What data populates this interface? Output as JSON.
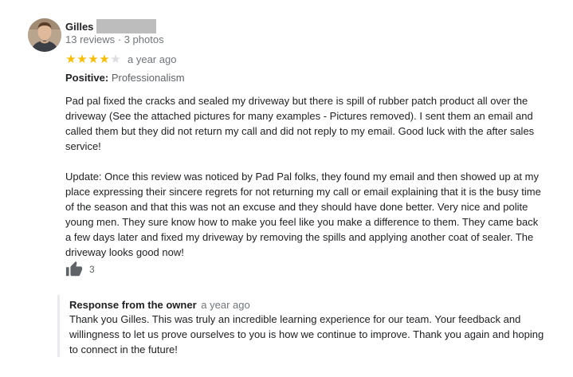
{
  "reviewer": {
    "name": "Gilles",
    "meta": "13 reviews · 3 photos",
    "avatar_icon": "person-photo-icon"
  },
  "rating": {
    "stars": 4,
    "max_stars": 5,
    "date": "a year ago",
    "star_color": "#fbbc04",
    "empty_star_color": "#dadce0"
  },
  "positive": {
    "label": "Positive:",
    "value": "Professionalism"
  },
  "review": {
    "paragraph1": "Pad pal fixed the cracks and sealed my driveway but there is spill of rubber patch product all over the driveway (See the attached pictures for many examples - Pictures removed). I sent them an email and called them but they did not return my call and did not reply to my email. Good luck with the after sales service!",
    "paragraph2": "Update: Once this review was noticed by Pad Pal folks, they found my email and then showed up at my place expressing their sincere  regrets for not returning my call or email explaining that it is the busy time of the season and that this was not an excuse and they should have done better. Very nice and polite young men. They sure know how to make you feel like you make a difference to them. They came back a few days later and fixed my driveway by removing the spills and applying another coat of sealer. The driveway looks good now!"
  },
  "likes": {
    "icon": "thumbs-up-icon",
    "count": "3"
  },
  "owner_response": {
    "label": "Response from the owner",
    "date": "a year ago",
    "text": "Thank you Gilles. This was truly an incredible learning experience for our team. Your feedback and willingness to let us prove ourselves to you is how we continue to improve. Thank you again and hoping to connect in the future!"
  }
}
